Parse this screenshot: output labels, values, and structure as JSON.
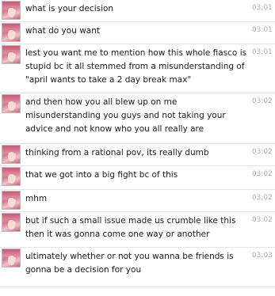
{
  "messages": [
    {
      "text": "what is your decision",
      "time": "03:01",
      "avatar": "user-avatar"
    },
    {
      "text": "what do you want",
      "time": "03:01",
      "avatar": "user-avatar"
    },
    {
      "text": "lest you want me to mention how this whole fiasco is stupid bc it all stemmed from a misunderstanding of \"april wants to take a 2 day break max\"",
      "time": "03:01",
      "avatar": "user-avatar"
    },
    {
      "text": "and then how you all blew up on me misunderstanding you guys and not taking your advice and not know who you all really are",
      "time": "03:02",
      "avatar": "user-avatar"
    },
    {
      "text": "thinking from a rational pov, its really dumb",
      "time": "03:02",
      "avatar": "user-avatar"
    },
    {
      "text": "that we got into a big fight bc of this",
      "time": "03:02",
      "avatar": "user-avatar"
    },
    {
      "text": "mhm",
      "time": "03:02",
      "avatar": "user-avatar"
    },
    {
      "text": "but if such a small issue made us crumble like this then it was gonna come one way or another",
      "time": "03:02",
      "avatar": "user-avatar"
    },
    {
      "text": "ultimately whether or not you wanna be friends is gonna be a decision for you",
      "time": "03:03",
      "avatar": "user-avatar"
    }
  ]
}
